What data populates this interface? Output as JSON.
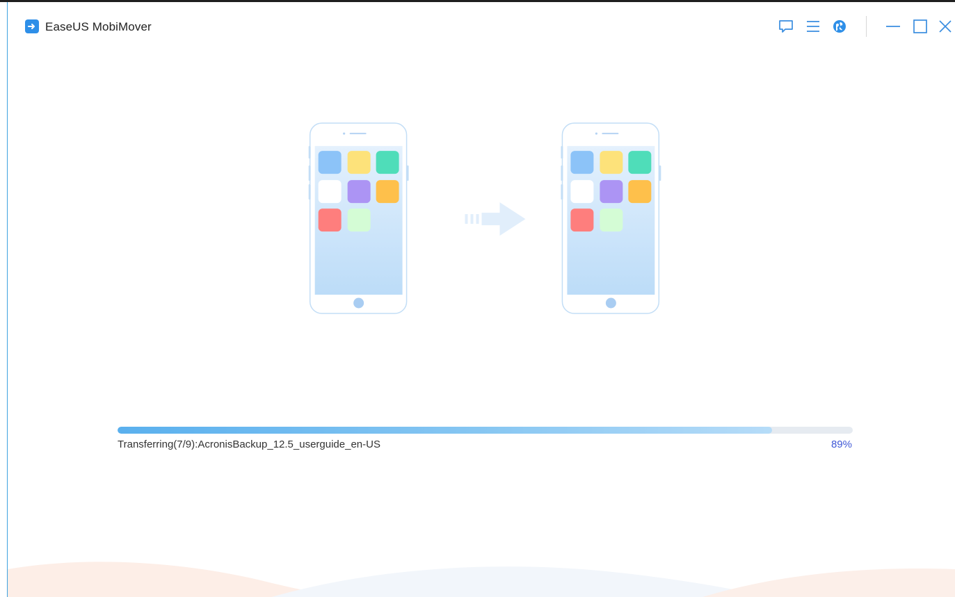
{
  "window": {
    "title": "EaseUS MobiMover",
    "controls": {
      "feedback_icon": "feedback-icon",
      "menu_icon": "menu-icon",
      "language_icon": "globe-icon",
      "minimize_icon": "minimize-icon",
      "maximize_icon": "maximize-icon",
      "close_icon": "close-icon"
    }
  },
  "transfer": {
    "status": "Transferring(7/9):AcronisBackup_12.5_userguide_en-US",
    "percent_label": "89%",
    "progress_fraction": 0.89,
    "source_device_icon": "phone-source-icon",
    "target_device_icon": "phone-target-icon",
    "direction_icon": "arrow-right-icon"
  },
  "colors": {
    "accent": "#2e8fe8",
    "percent": "#3f58d6",
    "phone_outline": "#bcdcf5",
    "app_tiles": [
      "#8cc3f8",
      "#fde27a",
      "#4fddb9",
      "#ffffff",
      "#ac94f4",
      "#fec04b",
      "#fe7e7d",
      "#d4fcd5"
    ]
  }
}
